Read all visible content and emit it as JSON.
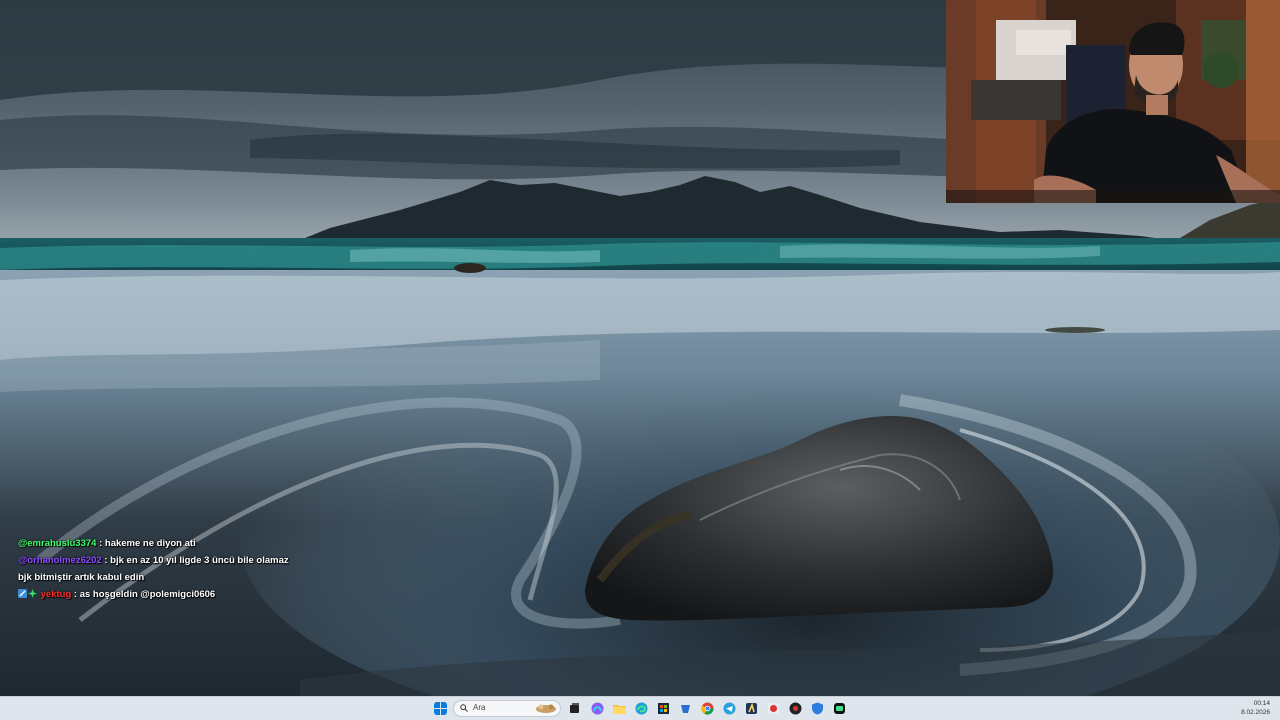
{
  "chat": {
    "messages": [
      {
        "user": "@emrahuslu3374",
        "user_color": "#3cff6a",
        "sep": " : ",
        "text": "hakeme ne diyon ati"
      },
      {
        "user": "@orhanolmez6202",
        "user_color": "#8a4cff",
        "sep": " : ",
        "text": "bjk en az 10 yıl ligde 3 üncü bile olamaz",
        "continuation": "bjk bitmiştir artık kabul edin"
      },
      {
        "user": "yektug",
        "user_color": "#ff2a2a",
        "sep": " : ",
        "text": "as hoşgeldin @polemigci0606",
        "badges": [
          "subscriber-badge",
          "sparkle-badge"
        ]
      }
    ]
  },
  "taskbar": {
    "search_placeholder": "Ara",
    "icons": [
      "windows-start-icon",
      "task-view-icon",
      "copilot-icon",
      "file-explorer-icon",
      "edge-icon",
      "store-icon",
      "app-icon",
      "chrome-icon",
      "telegram-icon",
      "app-icon-2",
      "app-icon-3",
      "app-icon-4",
      "security-icon",
      "app-icon-5"
    ],
    "clock_time": "00:14",
    "clock_date": "8.02.2026"
  },
  "colors": {
    "taskbar_bg": "#dfe5ec",
    "accent": "#0078d4"
  }
}
